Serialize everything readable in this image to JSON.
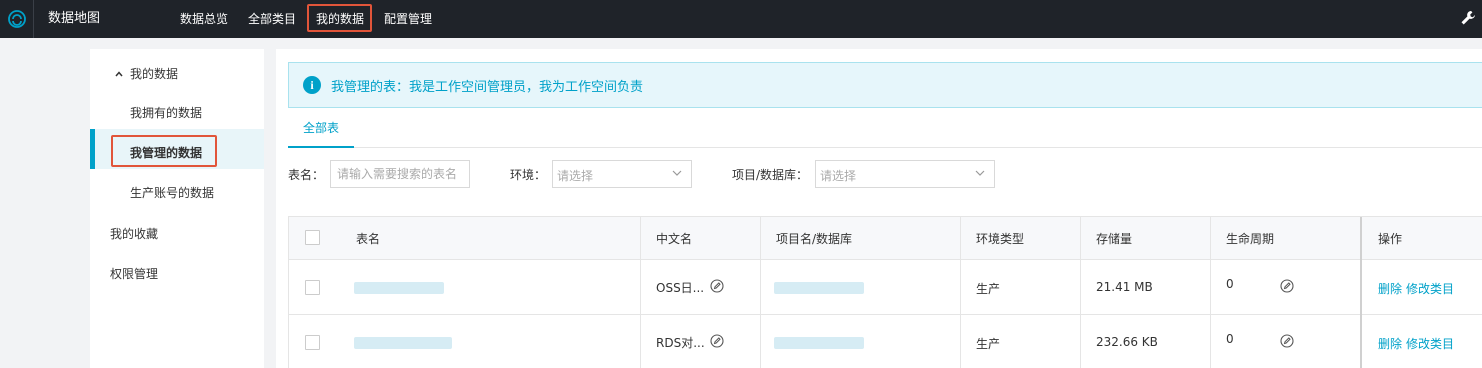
{
  "topbar": {
    "app_title": "数据地图",
    "nav": [
      "数据总览",
      "全部类目",
      "我的数据",
      "配置管理"
    ]
  },
  "sidebar": {
    "group_label": "我的数据",
    "items": [
      "我拥有的数据",
      "我管理的数据",
      "生产账号的数据"
    ],
    "favorites": "我的收藏",
    "permissions": "权限管理"
  },
  "notice": {
    "text": "我管理的表：我是工作空间管理员，我为工作空间负责"
  },
  "tabs": [
    "全部表"
  ],
  "filters": {
    "table_name_label": "表名：",
    "table_name_placeholder": "请输入需要搜索的表名",
    "env_label": "环境：",
    "env_placeholder": "请选择",
    "project_label": "项目/数据库：",
    "project_placeholder": "请选择"
  },
  "table": {
    "columns": [
      "表名",
      "中文名",
      "项目名/数据库",
      "环境类型",
      "存储量",
      "生命周期",
      "操作"
    ],
    "rows": [
      {
        "chinese_name": "OSS日...",
        "env": "生产",
        "storage": "21.41 MB",
        "lifecycle": "0",
        "delete": "删除",
        "modify": "修改类目"
      },
      {
        "chinese_name": "RDS对...",
        "env": "生产",
        "storage": "232.66 KB",
        "lifecycle": "0",
        "delete": "删除",
        "modify": "修改类目"
      }
    ]
  },
  "colors": {
    "accent": "#00a1c9",
    "topbar": "#1f2329",
    "highlight_box": "#e1553a"
  },
  "icons": [
    "logo-icon",
    "wrench-icon",
    "info-icon",
    "chevron-up-icon",
    "chevron-down-icon",
    "edit-icon"
  ]
}
